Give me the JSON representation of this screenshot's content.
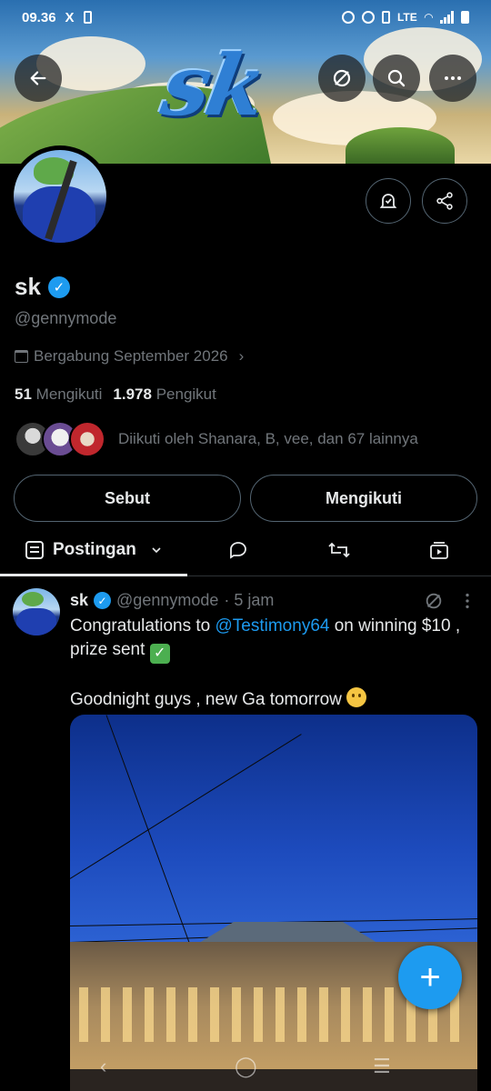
{
  "status_bar": {
    "time": "09.36",
    "x_icon": "X",
    "network_label": "LTE"
  },
  "banner": {
    "logo_text": "sk"
  },
  "header_actions": {
    "back_icon": "←",
    "search_icon": "⌕",
    "more_icon": "⋯"
  },
  "profile": {
    "name": "sk",
    "handle": "@gennymode",
    "joined": "Bergabung September 2026",
    "following_count": "51",
    "following_label": "Mengikuti",
    "followers_count": "1.978",
    "followers_label": "Pengikut",
    "followed_by": "Diikuti oleh Shanara, B, vee, dan 67 lainnya"
  },
  "actions": {
    "mention_label": "Sebut",
    "following_button_label": "Mengikuti"
  },
  "tabs": {
    "active_label": "Postingan"
  },
  "post": {
    "author_name": "sk",
    "author_handle": "@gennymode",
    "time_ago": "· 5 jam",
    "text_before_mention": "Congratulations to ",
    "mention": "@Testimony64",
    "text_after_mention": " on winning $10 , prize sent ",
    "text_line2": "Goodnight guys , new Ga tomorrow "
  },
  "fab_label": "+",
  "colors": {
    "accent": "#1d9bf0",
    "background": "#000000",
    "muted_text": "#71767b",
    "border": "#536471"
  }
}
